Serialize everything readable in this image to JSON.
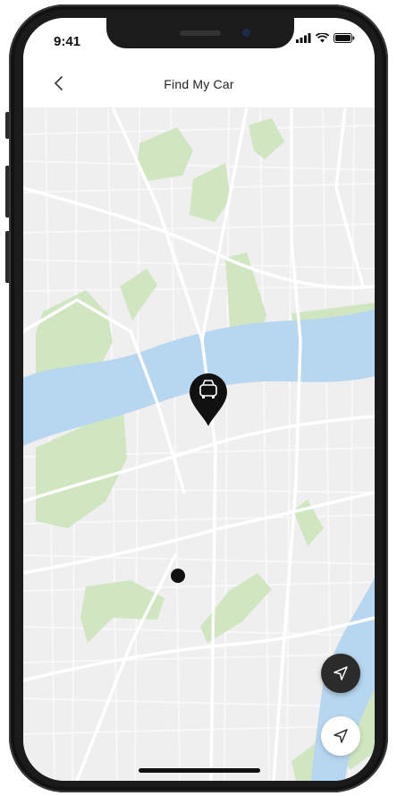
{
  "status_bar": {
    "time": "9:41"
  },
  "header": {
    "title": "Find My Car"
  },
  "icons": {
    "back": "chevron-left-icon",
    "car_pin": "car-location-pin-icon",
    "locate_dark": "navigation-arrow-icon",
    "locate_light": "navigation-arrow-outline-icon",
    "signal": "signal-icon",
    "wifi": "wifi-icon",
    "battery": "battery-icon"
  },
  "colors": {
    "water": "#b7d6ef",
    "park": "#cfe6c0",
    "land": "#efefef",
    "road": "#ffffff",
    "pin": "#111111"
  }
}
